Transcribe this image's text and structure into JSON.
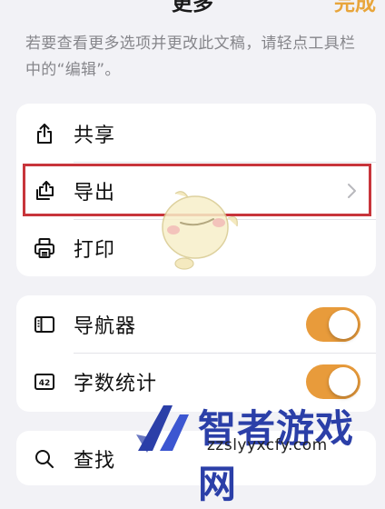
{
  "header": {
    "title": "更多",
    "done_label": "完成"
  },
  "description": "若要查看更多选项并更改此文稿，请轻点工具栏中的“编辑”。",
  "group1": {
    "share": {
      "label": "共享",
      "icon": "share-icon"
    },
    "export": {
      "label": "导出",
      "icon": "export-icon"
    },
    "print": {
      "label": "打印",
      "icon": "printer-icon"
    }
  },
  "group2": {
    "navigator": {
      "label": "导航器",
      "icon": "sidebar-icon",
      "enabled": true
    },
    "word_count": {
      "label": "字数统计",
      "icon": "word-count-icon",
      "icon_text": "42",
      "enabled": true
    }
  },
  "group3": {
    "find": {
      "label": "查找",
      "icon": "search-icon"
    }
  },
  "watermark": {
    "brand": "智者游戏网",
    "url": "zzslyyxcfy.com"
  },
  "colors": {
    "accent": "#e89b3b",
    "highlight": "#c8353b",
    "background": "#f2f2f6"
  }
}
